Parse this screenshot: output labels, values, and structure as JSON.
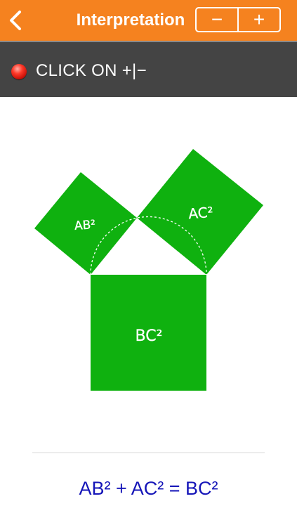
{
  "header": {
    "title": "Interpretation",
    "back_icon": "chevron-left-icon",
    "minus_label": "−",
    "plus_label": "+",
    "background_color": "#f5821f"
  },
  "status": {
    "indicator_color": "#e8231a",
    "text": "CLICK ON +|−"
  },
  "diagram": {
    "square_color": "#0fb10f",
    "labels": {
      "ab": "AB²",
      "ac": "AC²",
      "bc": "BC²"
    }
  },
  "footer": {
    "formula": "AB² + AC² = BC²",
    "formula_color": "#1515b8"
  }
}
